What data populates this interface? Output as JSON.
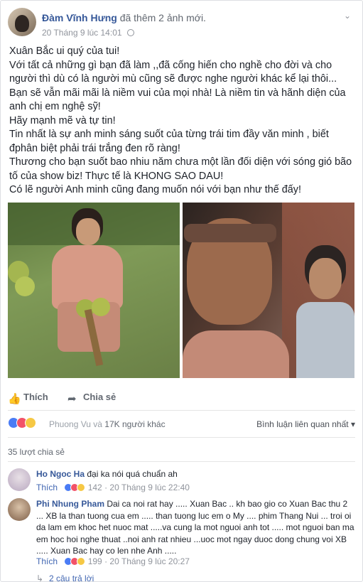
{
  "post": {
    "author": "Đàm Vĩnh Hưng",
    "action": "đã thêm 2 ảnh mới.",
    "timestamp": "20 Tháng 9 lúc 14:01",
    "privacy_icon": "globe-icon",
    "menu_icon": "chevron-down-icon",
    "text_lines": [
      "Xuân Bắc ui quý của tui!",
      "Với tất cả những gì bạn đã làm ,,đã cống hiến cho nghề cho đời và cho người thì dù có là người mù cũng sẽ được nghe người khác kể lại thôi...",
      "Bạn sẽ vẫn mãi mãi là niềm vui của mọi nhà! Là niềm tin và hãnh diện của anh chị em nghệ sỹ!",
      "Hãy mạnh mẽ và tự tin!",
      "Tin nhất là sự anh minh sáng suốt của từng trái tim đầy văn minh , biết đphân biệt phải trái trắng đen rõ ràng!",
      "Thương cho bạn suốt bao nhiu năm chưa một lần đối diện với sóng gió bão tố của show biz! Thực tế là KHONG SAO DAU!",
      "Có lẽ người Anh minh cũng đang muốn nói với bạn như thế đấy!"
    ]
  },
  "actions": {
    "like_label": "Thích",
    "like_icon": "thumbs-up-icon",
    "share_label": "Chia sẻ",
    "share_icon": "share-arrow-icon"
  },
  "reactions": {
    "names_partial": "Phuong Vu và",
    "others": "17K người khác",
    "filter_label": "Bình luận liên quan nhất",
    "colors": {
      "like": "#4a7cf5",
      "love": "#f25268",
      "haha": "#f6c844"
    }
  },
  "shares": {
    "label": "35 lượt chia sẻ"
  },
  "comments": [
    {
      "author": "Ho Ngoc Ha",
      "text": "đại ka nói quá chuẩn ah",
      "like_label": "Thích",
      "reaction_count": "142",
      "time": "20 Tháng 9 lúc 22:40"
    },
    {
      "author": "Phi Nhung Pham",
      "text": "Dai ca noi rat hay ..... Xuan Bac .. kh bao gio co Xuan Bac thu 2 ... XB la than tuong cua em ..... than tuong luc em o My .... phim Thang Nui ... troi oi da lam em khoc het nuoc mat .....va cung la mot nguoi anh tot ..... mot nguoi ban ma em hoc hoi nghe thuat ..noi anh rat nhieu ...uoc mot ngay duoc dong chung voi XB ..... Xuan Bac hay co len nhe Anh .....",
      "like_label": "Thích",
      "reaction_count": "199",
      "time": "20 Tháng 9 lúc 20:27"
    }
  ],
  "replies": {
    "label": "2 câu trả lời",
    "icon": "reply-arrow-icon"
  }
}
